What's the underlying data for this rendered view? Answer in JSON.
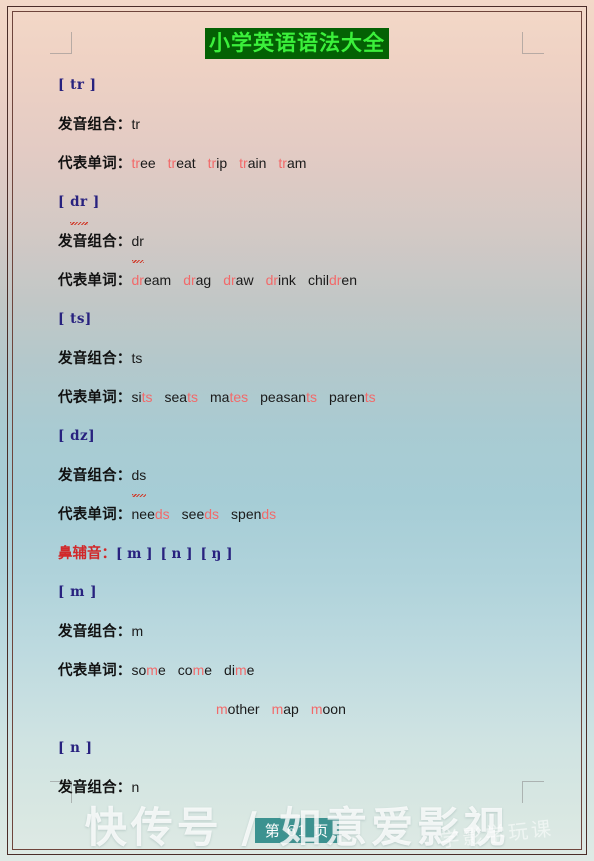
{
  "document": {
    "title": "小学英语语法大全",
    "title_bg": "#046104",
    "title_color": "#3bf03b",
    "page_indicator": "第 61 页",
    "watermark_main": "快传号 / 如意爱影视",
    "watermark_sub": "学影学玩课"
  },
  "labels": {
    "pronunciation": "发音组合：",
    "example_words": "代表单词：",
    "nasal_consonants": "鼻辅音："
  },
  "colors": {
    "phoneme": "#28227f",
    "label": "#111111",
    "highlight": "#f26a6a",
    "nasal_label": "#d1282a",
    "spellcheck": "#d03c2c"
  },
  "nasal_list": [
    "[ m ]",
    "[ n ]",
    "[ ŋ ]"
  ],
  "sections": [
    {
      "phoneme": "[ tr ]",
      "phoneme_spellcheck": false,
      "combo": "tr",
      "combo_spellcheck": false,
      "words": [
        {
          "pre": "",
          "hl": "tr",
          "post": "ee"
        },
        {
          "pre": "",
          "hl": "tr",
          "post": "eat"
        },
        {
          "pre": "",
          "hl": "tr",
          "post": "ip"
        },
        {
          "pre": "",
          "hl": "tr",
          "post": "ain"
        },
        {
          "pre": "",
          "hl": "tr",
          "post": "am"
        }
      ]
    },
    {
      "phoneme": "[ dr ]",
      "phoneme_spellcheck": true,
      "phoneme_spell_token": "dr",
      "combo": "dr",
      "combo_spellcheck": true,
      "words": [
        {
          "pre": "",
          "hl": "dr",
          "post": "eam"
        },
        {
          "pre": "",
          "hl": "dr",
          "post": "ag"
        },
        {
          "pre": "",
          "hl": "dr",
          "post": "aw"
        },
        {
          "pre": "",
          "hl": "dr",
          "post": "ink"
        },
        {
          "pre": "chil",
          "hl": "dr",
          "post": "en"
        }
      ]
    },
    {
      "phoneme": "[ ts]",
      "phoneme_spellcheck": false,
      "combo": "ts",
      "combo_spellcheck": false,
      "words": [
        {
          "pre": "si",
          "hl": "ts",
          "post": ""
        },
        {
          "pre": "sea",
          "hl": "ts",
          "post": ""
        },
        {
          "pre": "ma",
          "hl": "tes",
          "post": ""
        },
        {
          "pre": "peasan",
          "hl": "ts",
          "post": ""
        },
        {
          "pre": "paren",
          "hl": "ts",
          "post": ""
        }
      ]
    },
    {
      "phoneme": "[ dz]",
      "phoneme_spellcheck": false,
      "combo": "ds",
      "combo_spellcheck": true,
      "words": [
        {
          "pre": "nee",
          "hl": "ds",
          "post": ""
        },
        {
          "pre": "see",
          "hl": "ds",
          "post": ""
        },
        {
          "pre": "spen",
          "hl": "ds",
          "post": ""
        }
      ]
    },
    {
      "phoneme": "[ m ]",
      "phoneme_spellcheck": false,
      "combo": "m",
      "combo_spellcheck": false,
      "words": [
        {
          "pre": "so",
          "hl": "m",
          "post": "e"
        },
        {
          "pre": "co",
          "hl": "m",
          "post": "e"
        },
        {
          "pre": "di",
          "hl": "m",
          "post": "e"
        }
      ],
      "words_line2": [
        {
          "pre": "",
          "hl": "m",
          "post": "other"
        },
        {
          "pre": "",
          "hl": "m",
          "post": "ap"
        },
        {
          "pre": "",
          "hl": "m",
          "post": "oon"
        }
      ]
    },
    {
      "phoneme": "[ n ]",
      "phoneme_spellcheck": false,
      "combo": "n",
      "combo_spellcheck": false,
      "words": []
    }
  ]
}
